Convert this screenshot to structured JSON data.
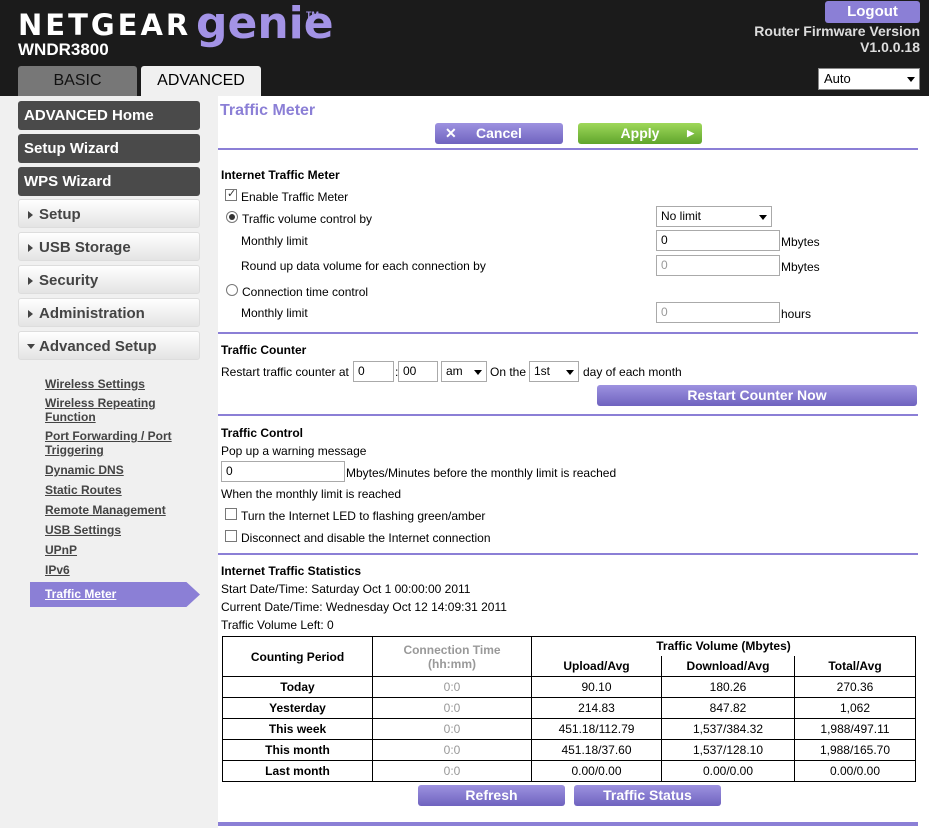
{
  "header": {
    "brand": "NETGEAR",
    "product": "genie",
    "trademark": "TM",
    "model": "WNDR3800",
    "logout_label": "Logout",
    "firmware_label": "Router Firmware Version",
    "firmware_version": "V1.0.0.18",
    "tabs": [
      {
        "label": "BASIC"
      },
      {
        "label": "ADVANCED"
      }
    ],
    "language_selected": "Auto"
  },
  "sidebar": {
    "dark_items": [
      {
        "label": "ADVANCED Home"
      },
      {
        "label": "Setup Wizard"
      },
      {
        "label": "WPS Wizard"
      }
    ],
    "menu_items": [
      {
        "label": "Setup"
      },
      {
        "label": "USB Storage"
      },
      {
        "label": "Security"
      },
      {
        "label": "Administration"
      },
      {
        "label": "Advanced Setup"
      }
    ],
    "sub_items": [
      {
        "label": "Wireless Settings"
      },
      {
        "label": "Wireless Repeating Function"
      },
      {
        "label": "Port Forwarding / Port Triggering"
      },
      {
        "label": "Dynamic DNS"
      },
      {
        "label": "Static Routes"
      },
      {
        "label": "Remote Management"
      },
      {
        "label": "USB Settings"
      },
      {
        "label": "UPnP"
      },
      {
        "label": "IPv6"
      },
      {
        "label": "Traffic Meter"
      }
    ]
  },
  "main": {
    "title": "Traffic Meter",
    "cancel_label": "Cancel",
    "apply_label": "Apply",
    "meter": {
      "heading": "Internet Traffic Meter",
      "enable_label": "Enable Traffic Meter",
      "enable_checked": true,
      "volume_label": "Traffic volume control by",
      "volume_select": "No limit",
      "monthly_label": "Monthly limit",
      "monthly_value": "0",
      "mbytes": "Mbytes",
      "roundup_label": "Round up data volume for each connection by",
      "roundup_value": "0",
      "time_label": "Connection time control",
      "time_monthly_label": "Monthly limit",
      "time_monthly_value": "0",
      "hours": "hours"
    },
    "counter": {
      "heading": "Traffic Counter",
      "restart_label": "Restart traffic counter at",
      "hour": "0",
      "colon": ":",
      "minute": "00",
      "ampm": "am",
      "on_the": "On the",
      "day": "1st",
      "day_suffix": "day of each month",
      "restart_now": "Restart Counter Now"
    },
    "control": {
      "heading": "Traffic Control",
      "popup_label": "Pop up a warning message",
      "popup_value": "0",
      "popup_suffix": "Mbytes/Minutes before the monthly limit is reached",
      "when_label": "When the monthly limit is reached",
      "led_label": "Turn the Internet LED to flashing green/amber",
      "disconnect_label": "Disconnect and disable the Internet connection"
    },
    "stats": {
      "heading": "Internet Traffic Statistics",
      "start": "Start Date/Time: Saturday Oct 1 00:00:00 2011",
      "current": "Current Date/Time: Wednesday Oct 12 14:09:31 2011",
      "left": "Traffic Volume Left: 0",
      "col_period": "Counting Period",
      "col_conn": "Connection Time",
      "col_conn_unit": "(hh:mm)",
      "col_volume": "Traffic Volume (Mbytes)",
      "col_upload": "Upload/Avg",
      "col_download": "Download/Avg",
      "col_total": "Total/Avg",
      "rows": [
        {
          "period": "Today",
          "conn": "0:0",
          "upload": "90.10",
          "download": "180.26",
          "total": "270.36"
        },
        {
          "period": "Yesterday",
          "conn": "0:0",
          "upload": "214.83",
          "download": "847.82",
          "total": "1,062"
        },
        {
          "period": "This week",
          "conn": "0:0",
          "upload": "451.18/112.79",
          "download": "1,537/384.32",
          "total": "1,988/497.11"
        },
        {
          "period": "This month",
          "conn": "0:0",
          "upload": "451.18/37.60",
          "download": "1,537/128.10",
          "total": "1,988/165.70"
        },
        {
          "period": "Last month",
          "conn": "0:0",
          "upload": "0.00/0.00",
          "download": "0.00/0.00",
          "total": "0.00/0.00"
        }
      ],
      "refresh_label": "Refresh",
      "status_label": "Traffic Status"
    }
  }
}
